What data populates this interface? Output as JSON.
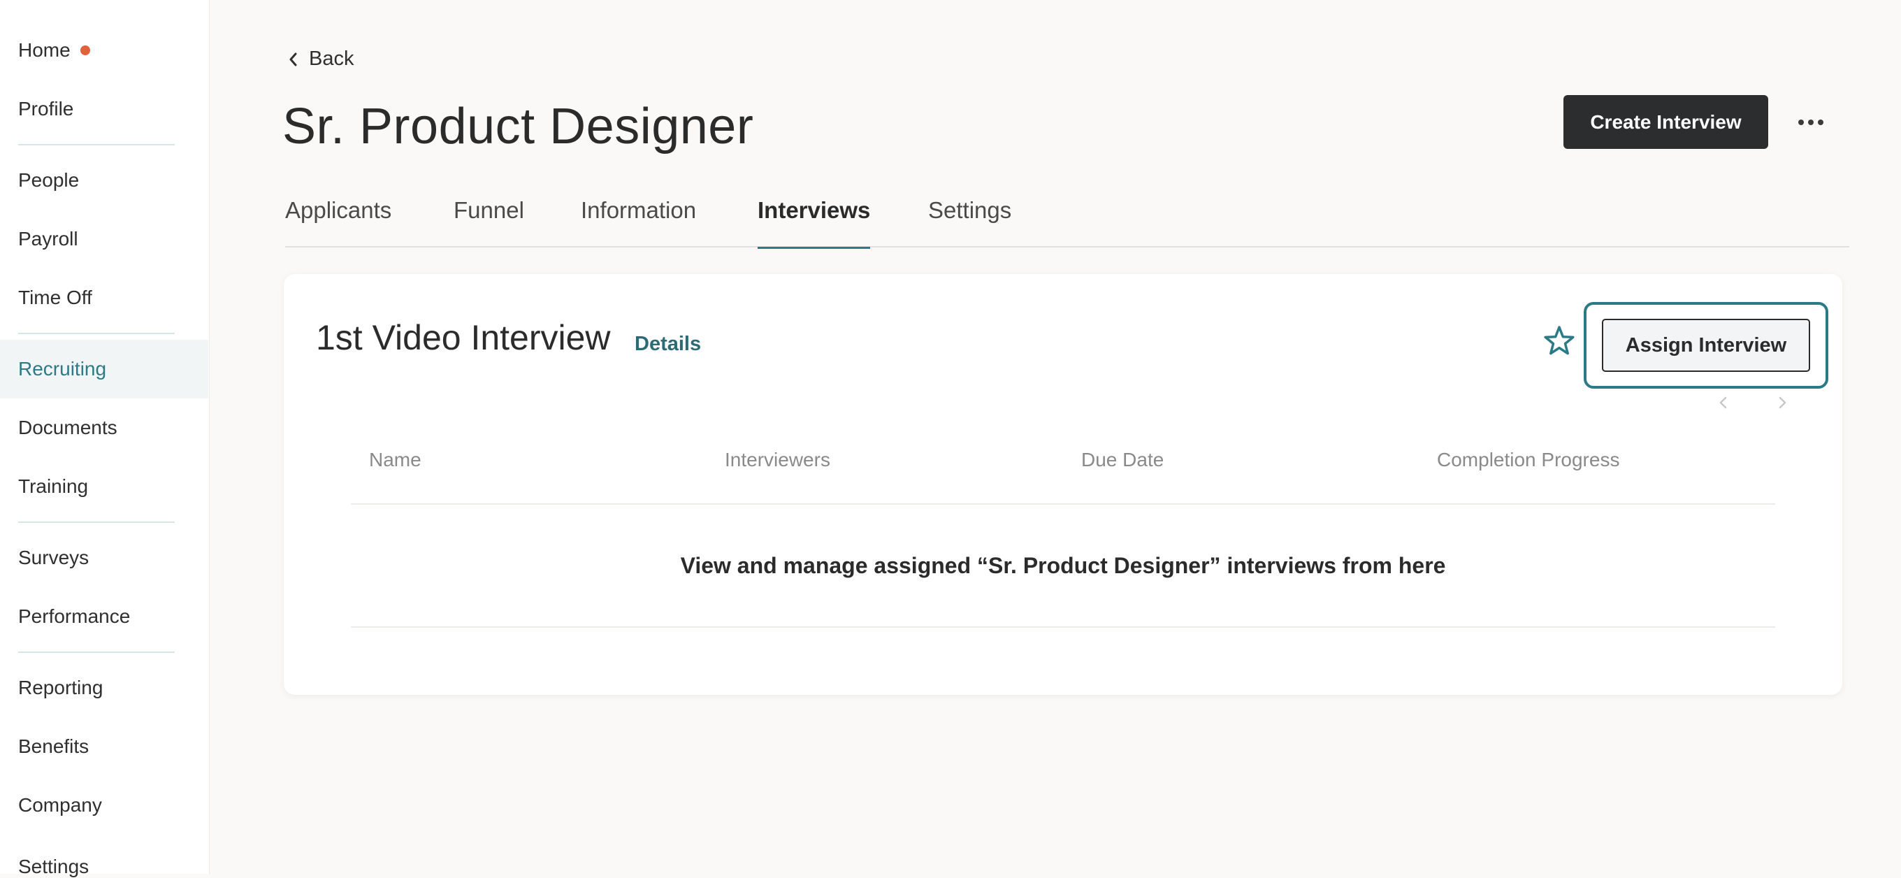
{
  "sidebar": {
    "items": [
      {
        "label": "Home"
      },
      {
        "label": "Profile"
      },
      {
        "label": "People"
      },
      {
        "label": "Payroll"
      },
      {
        "label": "Time Off"
      },
      {
        "label": "Recruiting"
      },
      {
        "label": "Documents"
      },
      {
        "label": "Training"
      },
      {
        "label": "Surveys"
      },
      {
        "label": "Performance"
      },
      {
        "label": "Reporting"
      },
      {
        "label": "Benefits"
      },
      {
        "label": "Company"
      },
      {
        "label": "Settings"
      }
    ],
    "active_item": "Recruiting"
  },
  "header": {
    "back_label": "Back",
    "title": "Sr. Product Designer",
    "create_label": "Create Interview"
  },
  "tabs": [
    {
      "label": "Applicants"
    },
    {
      "label": "Funnel"
    },
    {
      "label": "Information"
    },
    {
      "label": "Interviews"
    },
    {
      "label": "Settings"
    }
  ],
  "active_tab": "Interviews",
  "card": {
    "title": "1st Video Interview",
    "details_label": "Details",
    "assign_label": "Assign Interview",
    "columns": [
      "Name",
      "Interviewers",
      "Due Date",
      "Completion Progress"
    ],
    "empty_message": "View and manage assigned “Sr. Product Designer” interviews from here"
  },
  "colors": {
    "accent": "#2c7a86",
    "notification_dot": "#e0623a",
    "primary_button": "#2b2d2f"
  }
}
